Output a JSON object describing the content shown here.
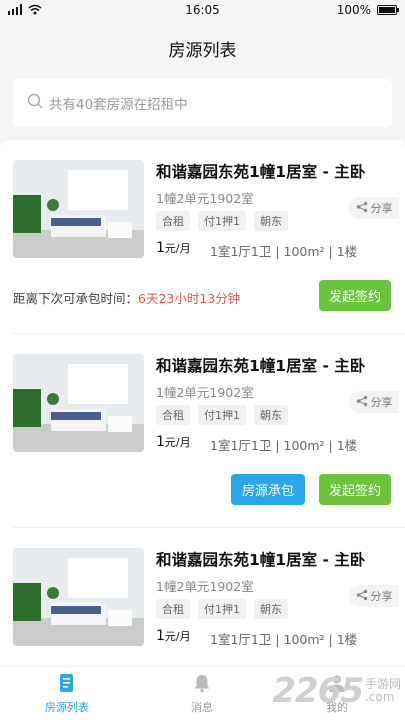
{
  "status_bar": {
    "time": "16:05",
    "battery": "100%"
  },
  "header": {
    "title": "房源列表"
  },
  "search": {
    "placeholder": "共有40套房源在招租中"
  },
  "listings": [
    {
      "title": "和谐嘉园东苑1幢1居室 - 主卧",
      "unit": "1幢2单元1902室",
      "tags": [
        "合租",
        "付1押1",
        "朝东"
      ],
      "share_label": "分享",
      "price": "1",
      "price_unit": "元/月",
      "specs": "1室1厅1卫 | 100m² | 1楼",
      "countdown_label": "距离下次可承包时间：",
      "countdown_value": "6天23小时13分钟",
      "buttons": [
        "发起签约"
      ]
    },
    {
      "title": "和谐嘉园东苑1幢1居室 - 主卧",
      "unit": "1幢2单元1902室",
      "tags": [
        "合租",
        "付1押1",
        "朝东"
      ],
      "share_label": "分享",
      "price": "1",
      "price_unit": "元/月",
      "specs": "1室1厅1卫 | 100m² | 1楼",
      "buttons": [
        "房源承包",
        "发起签约"
      ]
    },
    {
      "title": "和谐嘉园东苑1幢1居室 - 主卧",
      "unit": "1幢2单元1902室",
      "tags": [
        "合租",
        "付1押1",
        "朝东"
      ],
      "share_label": "分享",
      "price": "1",
      "price_unit": "元/月",
      "specs": "1室1厅1卫 | 100m² | 1楼"
    }
  ],
  "tabbar": {
    "items": [
      {
        "label": "房源列表",
        "icon": "document-icon",
        "active": true
      },
      {
        "label": "消息",
        "icon": "bell-icon",
        "active": false
      },
      {
        "label": "我的",
        "icon": "person-icon",
        "active": false
      }
    ]
  },
  "watermark": {
    "number": "2265",
    "text_top": "手游网",
    "text_bottom": ".com"
  },
  "colors": {
    "accent_blue": "#2aa6e9",
    "accent_green": "#6cc43c",
    "countdown_red": "#e9534c"
  }
}
